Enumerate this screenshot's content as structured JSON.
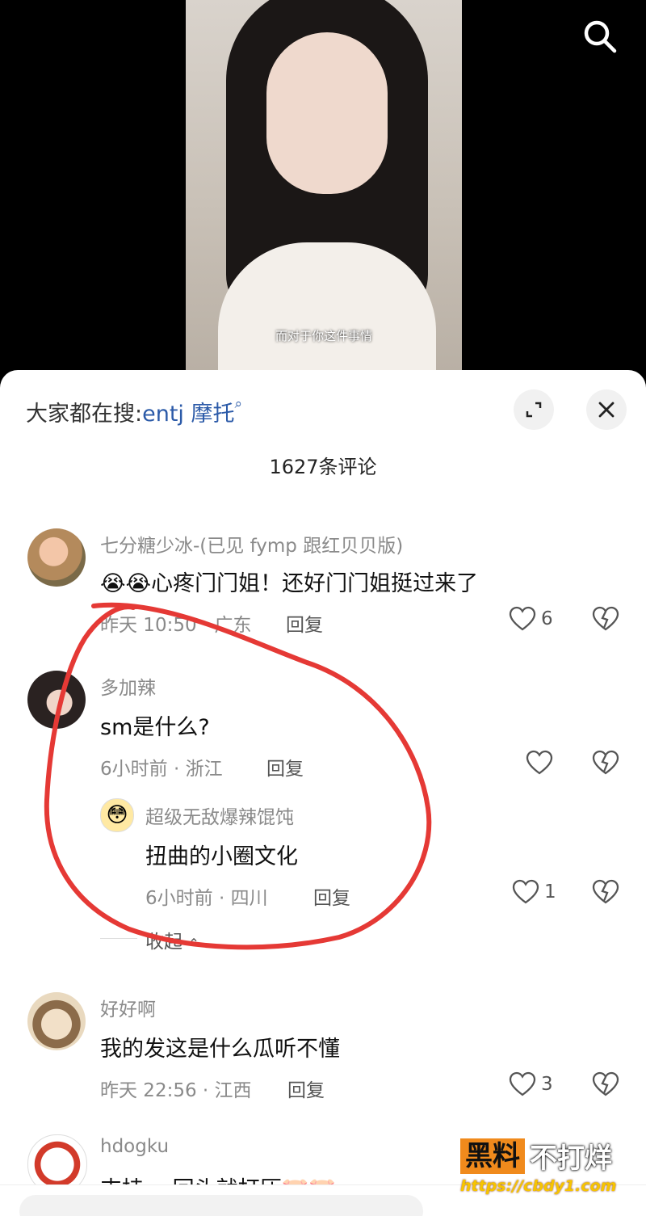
{
  "video": {
    "subtitle": "而对于你这件事情"
  },
  "sheet": {
    "hot_search_prefix": "大家都在搜:",
    "hot_search_keyword": "entj 摩托",
    "comment_count": "1627条评论"
  },
  "comments": [
    {
      "username": "七分糖少冰-(已见 fymp 跟红贝贝版)",
      "text": "心疼门门姐！还好门门姐挺过来了",
      "emoji": "😭😭",
      "meta": "昨天 10:50 · 广东",
      "reply_label": "回复",
      "likes": "6"
    },
    {
      "username": "多加辣",
      "text": "sm是什么?",
      "meta": "6小时前 · 浙江",
      "reply_label": "回复",
      "likes": ""
    },
    {
      "username": "超级无敌爆辣馄饨",
      "text": "扭曲的小圈文化",
      "meta": "6小时前 · 四川",
      "reply_label": "回复",
      "likes": "1",
      "collapse_label": "收起"
    },
    {
      "username": "好好啊",
      "text": "我的发这是什么瓜听不懂",
      "meta": "昨天 22:56 · 江西",
      "reply_label": "回复",
      "likes": "3"
    },
    {
      "username": "hdogku",
      "text": "支持 ，回头就打压🐷🐷"
    }
  ],
  "watermark": {
    "box_text": "黑料",
    "rest_text": "不打烊",
    "url": "https://cbdy1.com"
  },
  "colors": {
    "accent_link": "#2b5aa8",
    "annotation_red": "#e53935",
    "watermark_orange": "#f08a1c"
  }
}
